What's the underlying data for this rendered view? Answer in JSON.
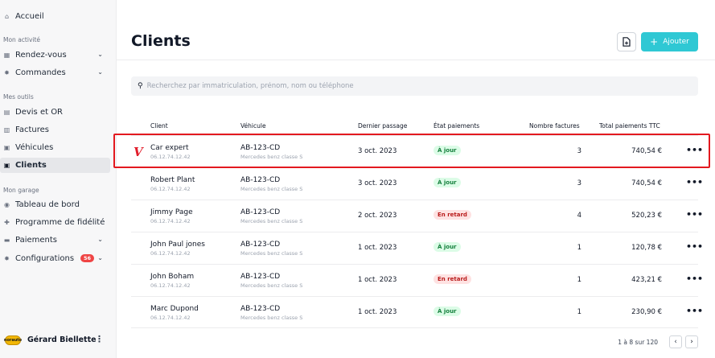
{
  "sidebar": {
    "home": {
      "label": "Accueil",
      "icon": "home-icon"
    },
    "sections": [
      {
        "label": "Mon activité"
      },
      {
        "label": "Mes outils"
      },
      {
        "label": "Mon garage"
      }
    ],
    "items": [
      {
        "label": "Rendez-vous",
        "icon": "calendar-icon",
        "chevron": "⌄"
      },
      {
        "label": "Commandes",
        "icon": "gear-icon",
        "chevron": "⌄"
      },
      {
        "label": "Devis et OR",
        "icon": "document-icon"
      },
      {
        "label": "Factures",
        "icon": "invoice-icon"
      },
      {
        "label": "Véhicules",
        "icon": "car-icon"
      },
      {
        "label": "Clients",
        "icon": "client-icon"
      },
      {
        "label": "Tableau de bord",
        "icon": "dashboard-icon"
      },
      {
        "label": "Programme de fidélité",
        "icon": "gift-icon"
      },
      {
        "label": "Paiements",
        "icon": "card-icon",
        "chevron": "⌄"
      },
      {
        "label": "Configurations",
        "icon": "settings-icon",
        "badge": "56",
        "chevron": "⌄"
      }
    ],
    "user": {
      "name": "Gérard Biellette",
      "logo_text": "norauto",
      "menu": "⋮"
    }
  },
  "header": {
    "title": "Clients",
    "add_label": "Ajouter",
    "accent": "#2fc8d4"
  },
  "search": {
    "placeholder": "Recherchez par immatriculation, prénom, nom ou téléphone"
  },
  "table": {
    "columns": [
      "Client",
      "Véhicule",
      "Dernier passage",
      "État paiements",
      "Nombre factures",
      "Total paiements TTC"
    ],
    "rows": [
      {
        "name": "Car expert",
        "phone": "06.12.74.12.42",
        "plate": "AB-123-CD",
        "model": "Mercedes benz classe S",
        "date": "3 oct. 2023",
        "status": "À jour",
        "status_kind": "ok",
        "count": "3",
        "total": "740,54 €",
        "logo": "V"
      },
      {
        "name": "Robert Plant",
        "phone": "06.12.74.12.42",
        "plate": "AB-123-CD",
        "model": "Mercedes benz classe S",
        "date": "3 oct. 2023",
        "status": "À jour",
        "status_kind": "ok",
        "count": "3",
        "total": "740,54 €"
      },
      {
        "name": "Jimmy Page",
        "phone": "06.12.74.12.42",
        "plate": "AB-123-CD",
        "model": "Mercedes benz classe S",
        "date": "2 oct. 2023",
        "status": "En retard",
        "status_kind": "late",
        "count": "4",
        "total": "520,23 €"
      },
      {
        "name": "John Paul jones",
        "phone": "06.12.74.12.42",
        "plate": "AB-123-CD",
        "model": "Mercedes benz classe S",
        "date": "1 oct. 2023",
        "status": "À jour",
        "status_kind": "ok",
        "count": "1",
        "total": "120,78 €"
      },
      {
        "name": "John Boham",
        "phone": "06.12.74.12.42",
        "plate": "AB-123-CD",
        "model": "Mercedes benz classe S",
        "date": "1 oct. 2023",
        "status": "En retard",
        "status_kind": "late",
        "count": "1",
        "total": "423,21 €"
      },
      {
        "name": "Marc Dupond",
        "phone": "06.12.74.12.42",
        "plate": "AB-123-CD",
        "model": "Mercedes benz classe S",
        "date": "1 oct. 2023",
        "status": "À jour",
        "status_kind": "ok",
        "count": "1",
        "total": "230,90 €"
      }
    ],
    "more": "•••"
  },
  "pagination": {
    "info": "1 à 8 sur 120",
    "prev": "‹",
    "next": "›"
  },
  "colors": {
    "highlight": "#e3191f",
    "ok_bg": "#dcfce7",
    "late_bg": "#fee2e2"
  }
}
